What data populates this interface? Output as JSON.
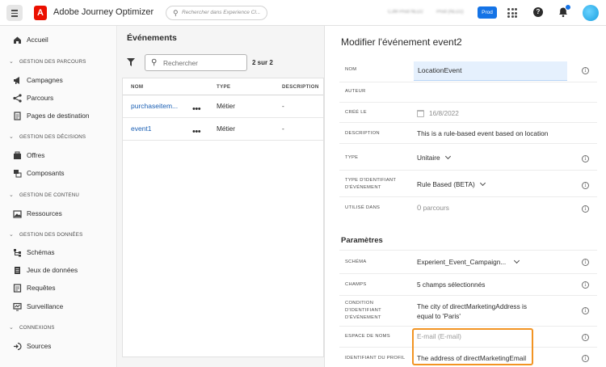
{
  "topbar": {
    "app_name": "Adobe Journey Optimizer",
    "search_placeholder": "Rechercher dans Experience Cl...",
    "org_name": "CJM Prod NLD2",
    "sandbox_name": "Prod (NLD2)",
    "prod_badge": "Prod"
  },
  "sidebar": {
    "home": "Accueil",
    "sections": [
      {
        "title": "GESTION DES PARCOURS",
        "items": [
          "Campagnes",
          "Parcours",
          "Pages de destination"
        ]
      },
      {
        "title": "GESTION DES DÉCISIONS",
        "items": [
          "Offres",
          "Composants"
        ]
      },
      {
        "title": "GESTION DE CONTENU",
        "items": [
          "Ressources"
        ]
      },
      {
        "title": "GESTION DES DONNÉES",
        "items": [
          "Schémas",
          "Jeux de données",
          "Requêtes",
          "Surveillance"
        ]
      },
      {
        "title": "CONNEXIONS",
        "items": [
          "Sources"
        ]
      }
    ]
  },
  "events_list": {
    "title": "Événements",
    "search_placeholder": "Rechercher",
    "count": "2 sur 2",
    "columns": [
      "NOM",
      "TYPE",
      "DESCRIPTION"
    ],
    "rows": [
      {
        "name": "purchaseitem...",
        "more": "•••",
        "type": "Métier",
        "description": "-"
      },
      {
        "name": "event1",
        "more": "•••",
        "type": "Métier",
        "description": "-"
      }
    ]
  },
  "detail": {
    "title": "Modifier l'événement event2",
    "fields": {
      "nom": {
        "label": "NOM",
        "value": "LocationEvent"
      },
      "auteur": {
        "label": "AUTEUR",
        "value": ""
      },
      "cree_le": {
        "label": "CRÉÉ LE",
        "value": "16/8/2022"
      },
      "description": {
        "label": "DESCRIPTION",
        "value": "This is a rule-based event based on location"
      },
      "type": {
        "label": "TYPE",
        "value": "Unitaire"
      },
      "type_id": {
        "label1": "TYPE D'IDENTIFIANT",
        "label2": "D'ÉVÉNEMENT",
        "value": "Rule Based (BETA)"
      },
      "utilise": {
        "label": "UTILISÉ DANS",
        "value_num": "0",
        "value_text": "parcours"
      }
    },
    "params_title": "Paramètres",
    "params": {
      "schema": {
        "label": "SCHÉMA",
        "value": "Experient_Event_Campaign..."
      },
      "champs": {
        "label": "CHAMPS",
        "value": "5 champs sélectionnés"
      },
      "condition": {
        "label1": "CONDITION",
        "label2": "D'IDENTIFIANT",
        "label3": "D'ÉVÉNEMENT",
        "value1": "The city of directMarketingAddress is",
        "value2": "equal to 'Paris'"
      },
      "espace": {
        "label": "ESPACE DE NOMS",
        "value": "E-mail (E-mail)"
      },
      "identifiant": {
        "label": "IDENTIFIANT DU PROFIL",
        "value": "The address of directMarketingEmail"
      }
    },
    "info_glyph": "i"
  },
  "colors": {
    "accent": "#1473e6",
    "highlight": "#f29423",
    "link": "#1a5fb4"
  }
}
